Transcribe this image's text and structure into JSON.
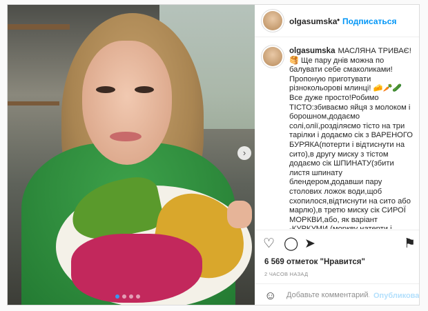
{
  "post": {
    "username": "olgasumska",
    "separator": "•",
    "follow_label": "Подписаться",
    "caption": "МАСЛЯНА ТРИВАЄ!🥞 Ще пару днів можна по балувати себе смаколиками!Пропоную приготувати різнокольорові млинці! 🧀🥕🥒Все дуже просто!Робимо ТІСТО:збиваємо яйця з молоком і борошном,додаємо солі,олії,розділяємо тісто на три тарілки і додаємо сік з ВАРЕНОГО БУРЯКА(потерти і відтиснути на сито),в другу миску з тістом додаємо сік ШПИНАТУ(збити листя шпинату блендером,додавши пару столових ложок води,щоб схопилося,відтиснути на сито або марлю),в третю миску сік СИРОЇ МОРКВИ,або, як варіант -КУРКУМИ,(моркву натерти і відтиснути на сито)!У нас вийшло три різнокольорових тіста, як світлофор!",
    "likes": "6 569 отметок \"Нравится\"",
    "time": "2 ЧАСОВ НАЗАД",
    "comment_placeholder": "Добавьте комментарий...",
    "publish_label": "Опубликовать"
  },
  "icons": {
    "like": "heart-icon",
    "comment": "comment-icon",
    "share": "share-icon",
    "save": "bookmark-icon",
    "emoji": "smile-icon",
    "next": "chevron-right-icon"
  },
  "carousel": {
    "count": 4,
    "active_index": 0
  },
  "colors": {
    "link": "#0095f6",
    "carousel_active": "#3897f0",
    "publish_disabled": "#b2dffc"
  }
}
